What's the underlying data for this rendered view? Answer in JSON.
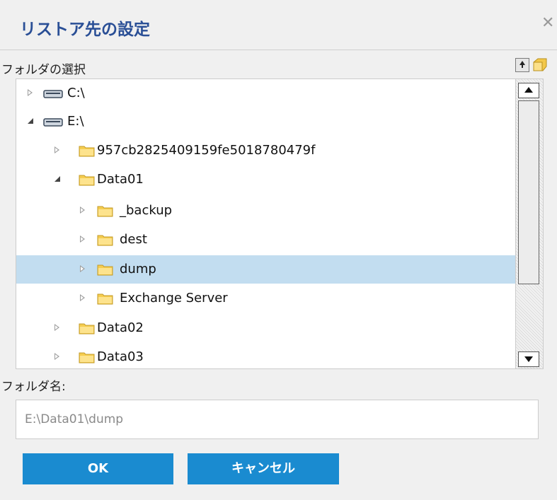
{
  "dialog": {
    "title": "リストア先の設定",
    "close_icon": "close-icon"
  },
  "folder_select": {
    "label": "フォルダの選択",
    "toolbar": {
      "up_icon": "up-arrow-icon",
      "new_folder_icon": "new-folder-icon"
    }
  },
  "tree": {
    "items": [
      {
        "label": "C:\\",
        "icon": "drive-icon",
        "state": "collapsed",
        "selected": false
      },
      {
        "label": "E:\\",
        "icon": "drive-icon",
        "state": "expanded",
        "selected": false
      },
      {
        "label": "957cb2825409159fe5018780479f",
        "icon": "folder-icon",
        "state": "collapsed",
        "selected": false
      },
      {
        "label": "Data01",
        "icon": "folder-icon",
        "state": "expanded",
        "selected": false
      },
      {
        "label": "_backup",
        "icon": "folder-icon",
        "state": "collapsed",
        "selected": false
      },
      {
        "label": "dest",
        "icon": "folder-icon",
        "state": "collapsed",
        "selected": false
      },
      {
        "label": "dump",
        "icon": "folder-icon",
        "state": "collapsed",
        "selected": true
      },
      {
        "label": "Exchange Server",
        "icon": "folder-icon",
        "state": "collapsed",
        "selected": false
      },
      {
        "label": "Data02",
        "icon": "folder-icon",
        "state": "collapsed",
        "selected": false
      },
      {
        "label": "Data03",
        "icon": "folder-icon",
        "state": "collapsed",
        "selected": false
      }
    ]
  },
  "folder_name": {
    "label": "フォルダ名:",
    "value": "E:\\Data01\\dump"
  },
  "buttons": {
    "ok": "OK",
    "cancel": "キャンセル"
  },
  "colors": {
    "title": "#2a4f96",
    "button": "#1a8bd0",
    "selection": "#c2ddf0"
  }
}
